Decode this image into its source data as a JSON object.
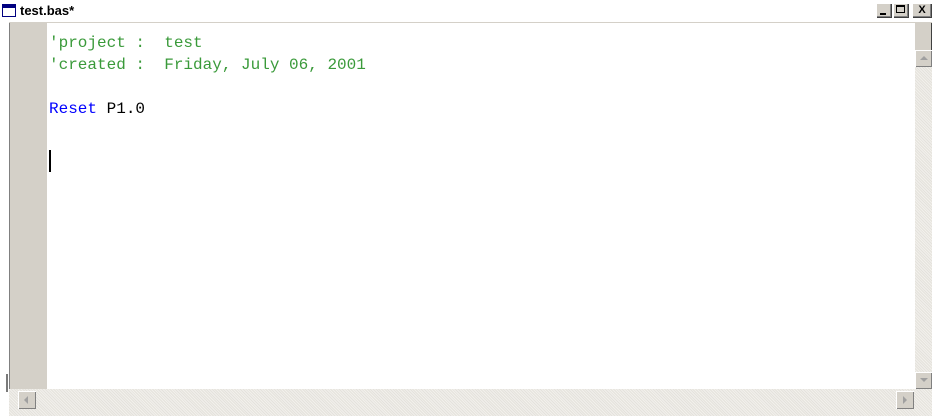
{
  "window": {
    "title": "test.bas*",
    "buttons": {
      "minimize": "_",
      "maximize": "□",
      "close": "X"
    }
  },
  "editor": {
    "lines": [
      {
        "text": "'project :  test",
        "style": "comment"
      },
      {
        "text": "'created :  Friday, July 06, 2001",
        "style": "comment"
      },
      {
        "text": "",
        "style": "plain"
      },
      {
        "keyword": "Reset",
        "rest": " P1.0",
        "style": "code"
      }
    ]
  },
  "colors": {
    "comment": "#3a9a3a",
    "keyword": "#0000ff",
    "text": "#000000",
    "chrome": "#d4d0c8"
  },
  "icons": {
    "app": "document-window-icon",
    "scroll_up": "arrow-up-icon",
    "scroll_down": "arrow-down-icon",
    "scroll_left": "arrow-left-icon",
    "scroll_right": "arrow-right-icon"
  }
}
